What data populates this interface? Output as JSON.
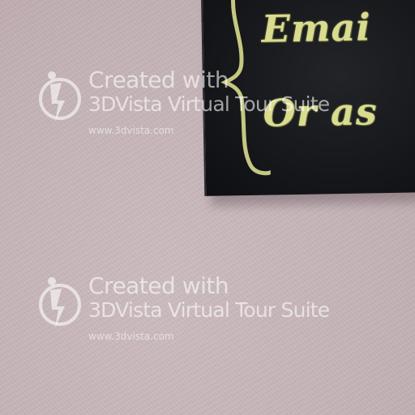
{
  "scene": {
    "wall_color": "#c8b8bc",
    "board_color": "#17181b",
    "chalk_color": "#d9dc8e"
  },
  "chalkboard": {
    "lines": [
      "Emai",
      "Or as"
    ]
  },
  "watermarks": [
    {
      "logo_icon": "3dvista-logo-icon",
      "line1": "Created with",
      "line2": "3DVista Virtual Tour Suite",
      "url": "www.3dvista.com"
    },
    {
      "logo_icon": "3dvista-logo-icon",
      "line1": "Created with",
      "line2": "3DVista Virtual Tour Suite",
      "url": "www.3dvista.com"
    }
  ]
}
